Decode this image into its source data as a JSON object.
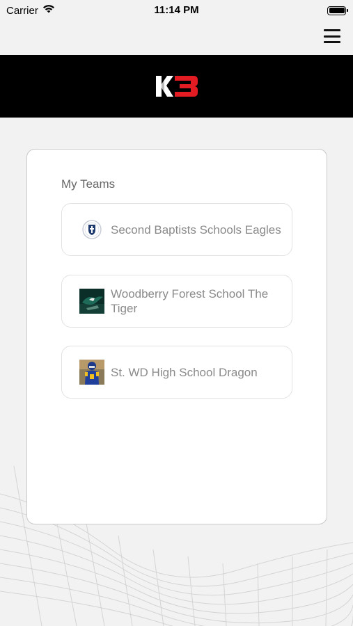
{
  "status_bar": {
    "carrier": "Carrier",
    "time": "11:14 PM"
  },
  "nav": {
    "menu_icon": "hamburger-menu-icon"
  },
  "brand": {
    "logo_text_k": "K",
    "logo_text_3": "3",
    "accent_color": "#e31b23"
  },
  "my_teams": {
    "title": "My Teams",
    "teams": [
      {
        "name": "Second Baptists Schools Eagles",
        "logo": "school-crest-icon"
      },
      {
        "name": "Woodberry Forest School The Tiger",
        "logo": "eagle-photo-icon"
      },
      {
        "name": "St. WD High School Dragon",
        "logo": "football-player-photo-icon"
      }
    ]
  }
}
